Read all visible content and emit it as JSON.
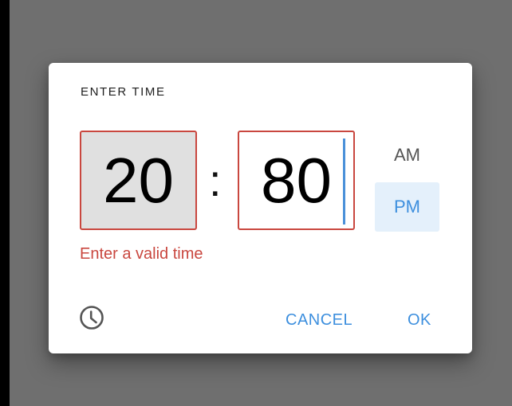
{
  "dialog": {
    "title": "ENTER TIME",
    "hour_value": "20",
    "separator": ":",
    "minute_value": "80",
    "am_label": "AM",
    "pm_label": "PM",
    "selected_period": "PM",
    "error_message": "Enter a valid time",
    "mode_toggle_icon": "clock-icon",
    "cancel_label": "CANCEL",
    "ok_label": "OK"
  },
  "colors": {
    "error": "#c9473f",
    "accent": "#3d8fde",
    "selected_period_bg": "#e4f0fb",
    "hour_field_bg": "#e0e0e0",
    "scrim": "#6f6f6f"
  }
}
